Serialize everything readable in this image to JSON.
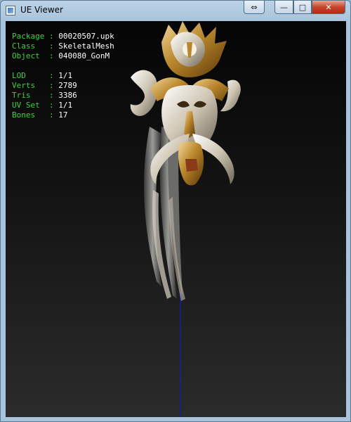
{
  "window": {
    "title": "UE Viewer",
    "controls": {
      "resize": "⇔",
      "minimize": "—",
      "maximize": "□",
      "close": "✕"
    }
  },
  "info_overlay": {
    "object_info": [
      {
        "label": "Package",
        "sep": " : ",
        "value": "00020507.upk"
      },
      {
        "label": "Class  ",
        "sep": " : ",
        "value": "SkeletalMesh"
      },
      {
        "label": "Object ",
        "sep": " : ",
        "value": "040080_GonM"
      }
    ],
    "mesh_stats": [
      {
        "label": "LOD    ",
        "sep": " : ",
        "value": "1/1"
      },
      {
        "label": "Verts  ",
        "sep": " : ",
        "value": "2789"
      },
      {
        "label": "Tris   ",
        "sep": " : ",
        "value": "3386"
      },
      {
        "label": "UV Set ",
        "sep": " : ",
        "value": "1/1"
      },
      {
        "label": "Bones  ",
        "sep": " : ",
        "value": "17"
      }
    ]
  },
  "colors": {
    "label_text": "#3fd23f",
    "value_text": "#ffffff",
    "axis_line": "#1a1aa0",
    "gold": "#b8862b"
  }
}
